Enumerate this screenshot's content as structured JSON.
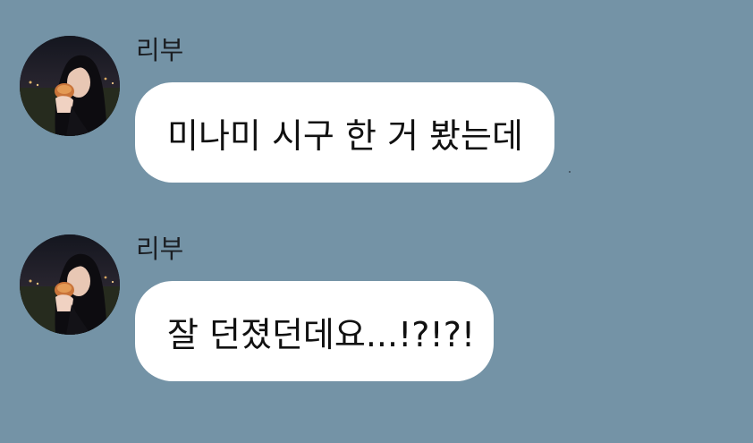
{
  "chat": {
    "messages": [
      {
        "sender": "리부",
        "text": "미나미 시구 한 거 봤는데",
        "avatar_icon": "profile-photo-avatar"
      },
      {
        "sender": "리부",
        "text": "잘 던졌던데요...!?!?!",
        "avatar_icon": "profile-photo-avatar"
      }
    ]
  },
  "colors": {
    "background": "#7493a6",
    "bubble": "#ffffff",
    "text": "#111111"
  }
}
